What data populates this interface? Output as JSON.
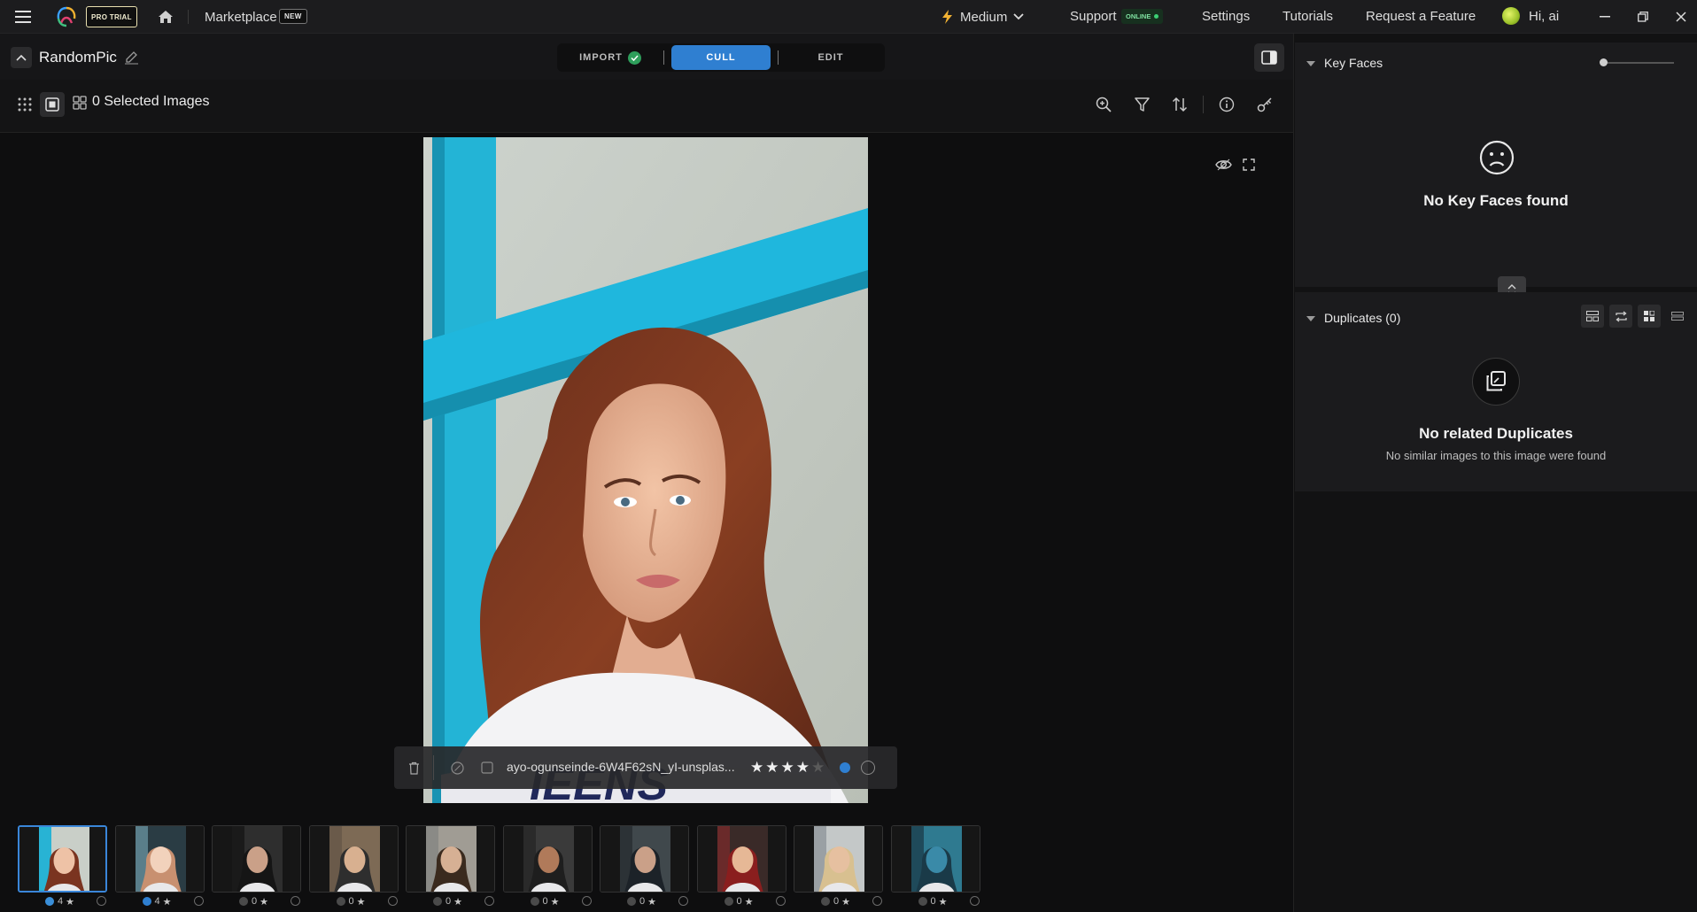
{
  "topbar": {
    "badge_trial": "PRO TRIAL",
    "marketplace_label": "Marketplace",
    "badge_new": "NEW",
    "speed_label": "Medium",
    "support_label": "Support",
    "support_status": "ONLINE",
    "settings_label": "Settings",
    "tutorials_label": "Tutorials",
    "request_label": "Request a Feature",
    "greeting": "Hi, ai"
  },
  "project": {
    "name": "RandomPic"
  },
  "stages": {
    "import_label": "IMPORT",
    "cull_label": "CULL",
    "edit_label": "EDIT",
    "active": "CULL"
  },
  "toolbar": {
    "selected_text": "0 Selected Images"
  },
  "viewer": {
    "file_name": "ayo-ogunseinde-6W4F62sN_yI-unsplas...",
    "rating": 4,
    "rating_max": 5,
    "shirt_text": "IEENS"
  },
  "filmstrip": [
    {
      "rating_label": "4",
      "color": "#3a8fd9",
      "active": true
    },
    {
      "rating_label": "4",
      "color": "#2f7fd1",
      "active": false
    },
    {
      "rating_label": "0",
      "color": "#4a4a4a",
      "active": false
    },
    {
      "rating_label": "0",
      "color": "#4a4a4a",
      "active": false
    },
    {
      "rating_label": "0",
      "color": "#4a4a4a",
      "active": false
    },
    {
      "rating_label": "0",
      "color": "#4a4a4a",
      "active": false
    },
    {
      "rating_label": "0",
      "color": "#4a4a4a",
      "active": false
    },
    {
      "rating_label": "0",
      "color": "#4a4a4a",
      "active": false
    },
    {
      "rating_label": "0",
      "color": "#4a4a4a",
      "active": false
    },
    {
      "rating_label": "0",
      "color": "#4a4a4a",
      "active": false
    }
  ],
  "key_faces": {
    "title": "Key Faces",
    "empty_title": "No Key Faces found"
  },
  "duplicates": {
    "title": "Duplicates (0)",
    "empty_title": "No related Duplicates",
    "empty_subtitle": "No similar images to this image were found"
  },
  "colors": {
    "accent": "#2f7fd1",
    "import_check": "#2e9e5b",
    "online": "#3ccf74",
    "trial_badge": "#e9e0b0",
    "star": "#e6e6e6"
  }
}
